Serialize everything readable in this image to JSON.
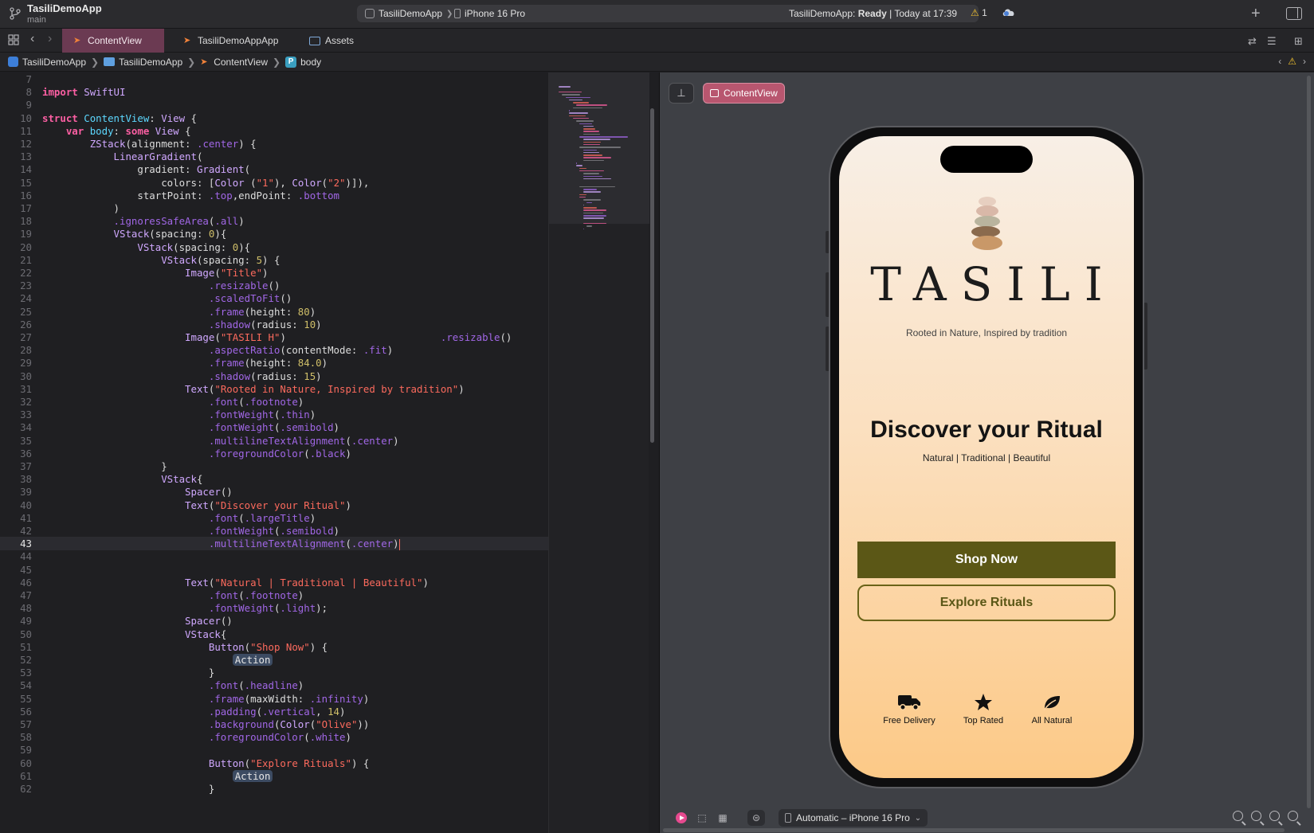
{
  "toolbar": {
    "project_name": "TasiliDemoApp",
    "branch": "main",
    "scheme": "TasiliDemoApp",
    "destination": "iPhone 16 Pro",
    "status_app": "TasiliDemoApp:",
    "status_state": "Ready",
    "status_time": "| Today at 17:39",
    "warning_count": "1"
  },
  "tabs": [
    {
      "label": "ContentView",
      "active": true
    },
    {
      "label": "TasiliDemoAppApp",
      "active": false
    },
    {
      "label": "Assets",
      "active": false
    }
  ],
  "breadcrumb": [
    "TasiliDemoApp",
    "TasiliDemoApp",
    "ContentView",
    "body"
  ],
  "editor": {
    "current_line": 43,
    "lines": [
      {
        "n": "7",
        "t": ""
      },
      {
        "n": "8",
        "t": "import SwiftUI"
      },
      {
        "n": "9",
        "t": ""
      },
      {
        "n": "10",
        "t": "struct ContentView: View {"
      },
      {
        "n": "11",
        "t": "    var body: some View {"
      },
      {
        "n": "12",
        "t": "        ZStack(alignment: .center) {"
      },
      {
        "n": "13",
        "t": "            LinearGradient("
      },
      {
        "n": "14",
        "t": "                gradient: Gradient("
      },
      {
        "n": "15",
        "t": "                    colors: [Color (\"1\"), Color(\"2\")]),"
      },
      {
        "n": "16",
        "t": "                startPoint: .top,endPoint: .bottom"
      },
      {
        "n": "17",
        "t": "            )"
      },
      {
        "n": "18",
        "t": "            .ignoresSafeArea(.all)"
      },
      {
        "n": "19",
        "t": "            VStack(spacing: 0){"
      },
      {
        "n": "20",
        "t": "                VStack(spacing: 0){"
      },
      {
        "n": "21",
        "t": "                    VStack(spacing: 5) {"
      },
      {
        "n": "22",
        "t": "                        Image(\"Title\")"
      },
      {
        "n": "23",
        "t": "                            .resizable()"
      },
      {
        "n": "24",
        "t": "                            .scaledToFit()"
      },
      {
        "n": "25",
        "t": "                            .frame(height: 80)"
      },
      {
        "n": "26",
        "t": "                            .shadow(radius: 10)"
      },
      {
        "n": "27",
        "t": "                        Image(\"TASILI H\")                          .resizable()"
      },
      {
        "n": "28",
        "t": "                            .aspectRatio(contentMode: .fit)"
      },
      {
        "n": "29",
        "t": "                            .frame(height: 84.0)"
      },
      {
        "n": "30",
        "t": "                            .shadow(radius: 15)"
      },
      {
        "n": "31",
        "t": "                        Text(\"Rooted in Nature, Inspired by tradition\")"
      },
      {
        "n": "32",
        "t": "                            .font(.footnote)"
      },
      {
        "n": "33",
        "t": "                            .fontWeight(.thin)"
      },
      {
        "n": "34",
        "t": "                            .fontWeight(.semibold)"
      },
      {
        "n": "35",
        "t": "                            .multilineTextAlignment(.center)"
      },
      {
        "n": "36",
        "t": "                            .foregroundColor(.black)"
      },
      {
        "n": "37",
        "t": "                    }"
      },
      {
        "n": "38",
        "t": "                    VStack{"
      },
      {
        "n": "39",
        "t": "                        Spacer()"
      },
      {
        "n": "40",
        "t": "                        Text(\"Discover your Ritual\")"
      },
      {
        "n": "41",
        "t": "                            .font(.largeTitle)"
      },
      {
        "n": "42",
        "t": "                            .fontWeight(.semibold)"
      },
      {
        "n": "43",
        "t": "                            .multilineTextAlignment(.center)"
      },
      {
        "n": "44",
        "t": ""
      },
      {
        "n": "45",
        "t": ""
      },
      {
        "n": "46",
        "t": "                        Text(\"Natural | Traditional | Beautiful\")"
      },
      {
        "n": "47",
        "t": "                            .font(.footnote)"
      },
      {
        "n": "48",
        "t": "                            .fontWeight(.light);"
      },
      {
        "n": "49",
        "t": "                        Spacer()"
      },
      {
        "n": "50",
        "t": "                        VStack{"
      },
      {
        "n": "51",
        "t": "                            Button(\"Shop Now\") {"
      },
      {
        "n": "52",
        "t": "                                Action"
      },
      {
        "n": "53",
        "t": "                            }"
      },
      {
        "n": "54",
        "t": "                            .font(.headline)"
      },
      {
        "n": "55",
        "t": "                            .frame(maxWidth: .infinity)"
      },
      {
        "n": "56",
        "t": "                            .padding(.vertical, 14)"
      },
      {
        "n": "57",
        "t": "                            .background(Color(\"Olive\"))"
      },
      {
        "n": "58",
        "t": "                            .foregroundColor(.white)"
      },
      {
        "n": "59",
        "t": ""
      },
      {
        "n": "60",
        "t": "                            Button(\"Explore Rituals\") {"
      },
      {
        "n": "61",
        "t": "                                Action"
      },
      {
        "n": "62",
        "t": "                            }"
      }
    ]
  },
  "preview": {
    "pill_label": "ContentView",
    "brand": "TASILI",
    "tagline": "Rooted in Nature, Inspired by tradition",
    "headline": "Discover your Ritual",
    "subline": "Natural | Traditional | Beautiful",
    "primary_button": "Shop Now",
    "secondary_button": "Explore Rituals",
    "features": [
      {
        "label": "Free Delivery",
        "icon": "truck-icon"
      },
      {
        "label": "Top Rated",
        "icon": "star-icon"
      },
      {
        "label": "All Natural",
        "icon": "leaf-icon"
      }
    ],
    "device_selector": "Automatic – iPhone 16 Pro"
  },
  "colors": {
    "accent_tab": "#6b3a52",
    "olive": "#5b5716",
    "gradient_top": "#f8efe6",
    "gradient_bottom": "#fcc987",
    "warning": "#f2c12e"
  }
}
